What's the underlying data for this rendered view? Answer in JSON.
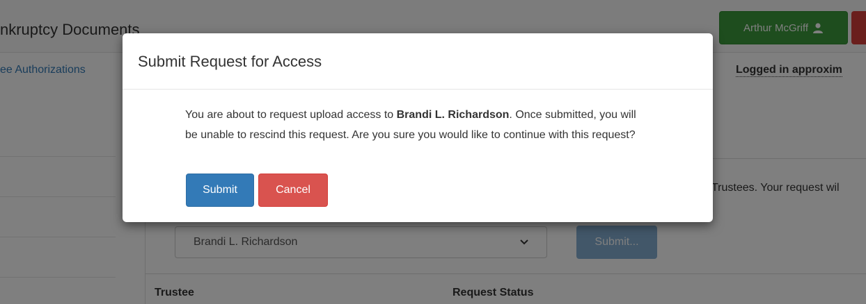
{
  "header": {
    "app_title": "nkruptcy Documents",
    "user_name": "Arthur McGriff"
  },
  "nav": {
    "authorizations_link": "ee Authorizations",
    "logged_in_text": "Logged in approxim"
  },
  "main": {
    "trustees_text": "Trustees. Your request wil",
    "trustee_select_value": "Brandi L. Richardson",
    "submit_label": "Submit...",
    "table_headers": [
      "Trustee",
      "Request Status"
    ]
  },
  "modal": {
    "title": "Submit Request for Access",
    "body_prefix": "You are about to request upload access to ",
    "body_name": "Brandi L. Richardson",
    "body_suffix": ". Once submitted, you will be unable to rescind this request. Are you sure you would like to continue with this request?",
    "submit_label": "Submit",
    "cancel_label": "Cancel"
  },
  "colors": {
    "primary": "#337ab7",
    "success": "#3c9a3c",
    "danger": "#d9534f"
  },
  "icons": {
    "user": "user-icon",
    "dropdown": "chevron-down-icon"
  }
}
